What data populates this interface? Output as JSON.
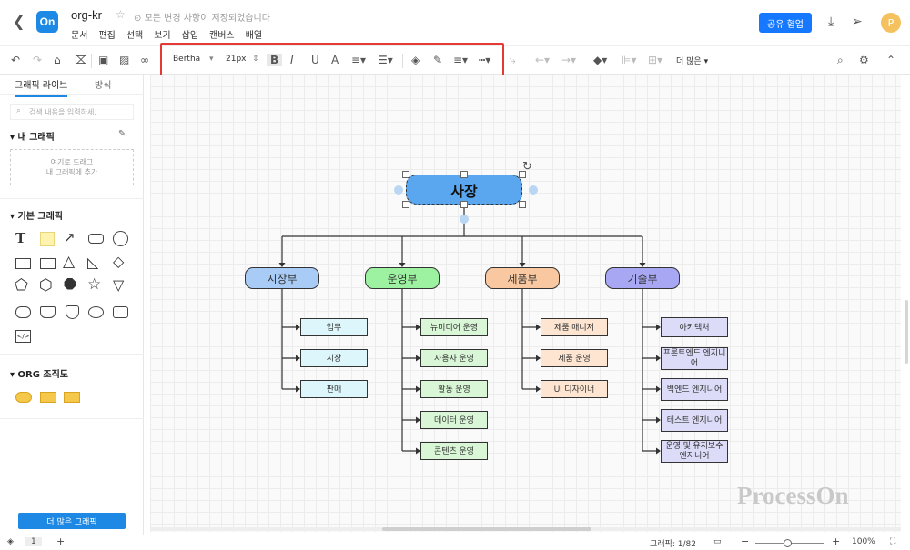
{
  "app": {
    "logo_text": "On",
    "doc_name": "org-kr",
    "saved_status": "모든 변경 사항이 저장되었습니다",
    "menu": [
      "문서",
      "편집",
      "선택",
      "보기",
      "삽입",
      "캔버스",
      "배열"
    ],
    "share_label": "공유 협업",
    "avatar_letter": "P"
  },
  "toolbar": {
    "font_family": "Bertha",
    "font_size": "21px",
    "more_label": "더 많은"
  },
  "sidebar": {
    "tabs": [
      "그래픽 라이브",
      "방식"
    ],
    "search_placeholder": "검색 내용을 입력하세.",
    "my_graphics_title": "내 그래픽",
    "drop_hint_line1": "여기로 드래그",
    "drop_hint_line2": "내 그래픽에 추가",
    "basic_title": "기본 그래픽",
    "org_title": "ORG 조직도",
    "more_button": "더 많은 그래픽"
  },
  "diagram": {
    "root": "사장",
    "departments": [
      {
        "name": "시장부",
        "color": "#a9ccf7",
        "leaf_color": "#ddf6fb",
        "children": [
          "업무",
          "시장",
          "판매"
        ]
      },
      {
        "name": "운영부",
        "color": "#9cf2a0",
        "leaf_color": "#d9f7d6",
        "children": [
          "뉴미디어 운영",
          "사용자 운영",
          "활동 운영",
          "데이터 운영",
          "콘텐츠 운영"
        ]
      },
      {
        "name": "제품부",
        "color": "#f9c8a0",
        "leaf_color": "#fde5d1",
        "children": [
          "제품 매니저",
          "제품 운영",
          "UI 디자이너"
        ]
      },
      {
        "name": "기술부",
        "color": "#a7a7f4",
        "leaf_color": "#dcdcf8",
        "children": [
          "아키텍처",
          "프론트엔드 엔지니어",
          "백엔드 엔지니어",
          "테스트 엔지니어",
          "운영 및 유지보수 엔지니어"
        ]
      }
    ],
    "root_color": "#5aa7f0"
  },
  "statusbar": {
    "page": "1",
    "graphic_count": "그래픽: 1/82",
    "zoom": "100%"
  },
  "watermark": "ProcessOn"
}
